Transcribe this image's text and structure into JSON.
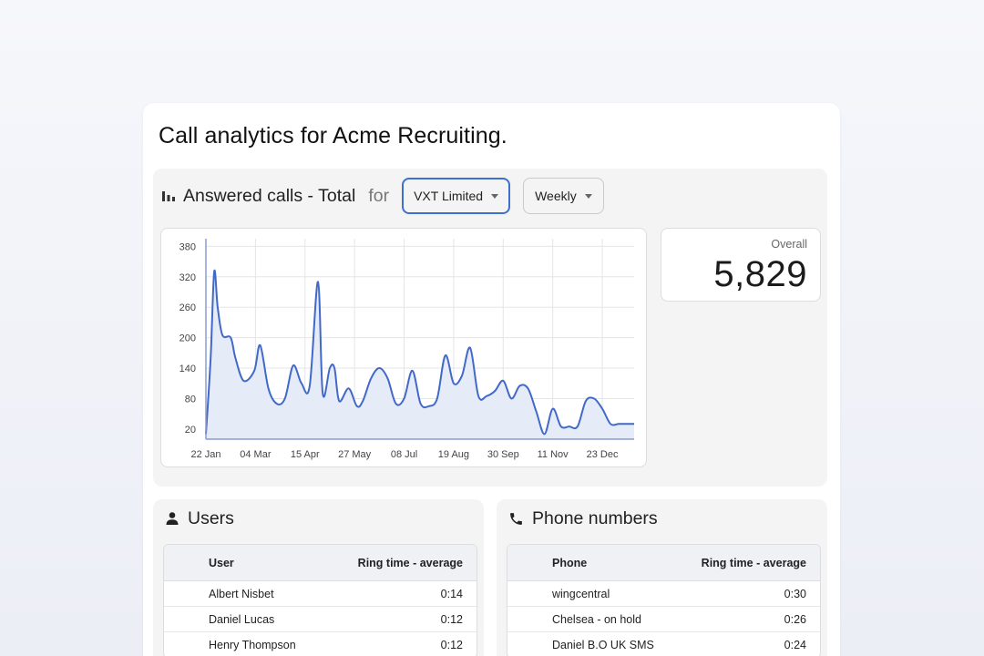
{
  "page": {
    "title": "Call analytics for Acme Recruiting."
  },
  "answered": {
    "title": "Answered calls - Total",
    "for_label": "for",
    "company_select": "VXT Limited",
    "period_select": "Weekly",
    "overall_label": "Overall",
    "overall_value": "5,829"
  },
  "chart_data": {
    "type": "area",
    "x_ticks": [
      "22 Jan",
      "04 Mar",
      "15 Apr",
      "27 May",
      "08 Jul",
      "19 Aug",
      "30 Sep",
      "11 Nov",
      "23 Dec"
    ],
    "y_ticks": [
      380,
      320,
      260,
      200,
      140,
      80,
      20
    ],
    "ylim": [
      0,
      395
    ],
    "x_start": "2023-01-22",
    "x_end": "2024-01-20",
    "grid": true,
    "color": "#4169c8",
    "fill": "#e6ebf8",
    "series": [
      {
        "x": [
          "2023-01-22",
          "2023-01-26",
          "2023-01-29",
          "2023-02-01",
          "2023-02-05",
          "2023-02-12",
          "2023-02-16",
          "2023-02-23",
          "2023-03-04",
          "2023-03-09",
          "2023-03-16",
          "2023-03-23",
          "2023-03-30",
          "2023-04-06",
          "2023-04-13",
          "2023-04-20",
          "2023-04-27",
          "2023-05-01",
          "2023-05-07",
          "2023-05-11",
          "2023-05-15",
          "2023-05-23",
          "2023-05-30",
          "2023-06-04",
          "2023-06-11",
          "2023-06-18",
          "2023-06-25",
          "2023-07-02",
          "2023-07-09",
          "2023-07-16",
          "2023-07-23",
          "2023-07-30",
          "2023-08-06",
          "2023-08-13",
          "2023-08-20",
          "2023-08-27",
          "2023-09-03",
          "2023-09-10",
          "2023-09-17",
          "2023-09-24",
          "2023-10-01",
          "2023-10-08",
          "2023-10-15",
          "2023-10-22",
          "2023-10-29",
          "2023-11-05",
          "2023-11-12",
          "2023-11-19",
          "2023-11-26",
          "2023-12-03",
          "2023-12-10",
          "2023-12-17",
          "2023-12-24",
          "2023-12-31",
          "2024-01-07",
          "2024-01-14",
          "2024-01-20"
        ],
        "y": [
          10,
          160,
          330,
          260,
          205,
          200,
          160,
          115,
          135,
          185,
          100,
          70,
          80,
          145,
          110,
          105,
          310,
          90,
          140,
          140,
          75,
          100,
          65,
          75,
          120,
          140,
          120,
          70,
          80,
          135,
          70,
          65,
          80,
          165,
          110,
          125,
          180,
          85,
          85,
          95,
          115,
          80,
          105,
          100,
          55,
          10,
          60,
          25,
          25,
          25,
          75,
          80,
          60,
          30,
          30,
          30,
          30
        ]
      }
    ]
  },
  "users": {
    "title": "Users",
    "headers": [
      "User",
      "Ring time - average"
    ],
    "rows": [
      [
        "Albert Nisbet",
        "0:14"
      ],
      [
        "Daniel Lucas",
        "0:12"
      ],
      [
        "Henry Thompson",
        "0:12"
      ]
    ]
  },
  "phones": {
    "title": "Phone numbers",
    "headers": [
      "Phone",
      "Ring time - average"
    ],
    "rows": [
      [
        "wingcentral",
        "0:30"
      ],
      [
        "Chelsea - on hold",
        "0:26"
      ],
      [
        "Daniel B.O UK SMS",
        "0:24"
      ]
    ]
  }
}
